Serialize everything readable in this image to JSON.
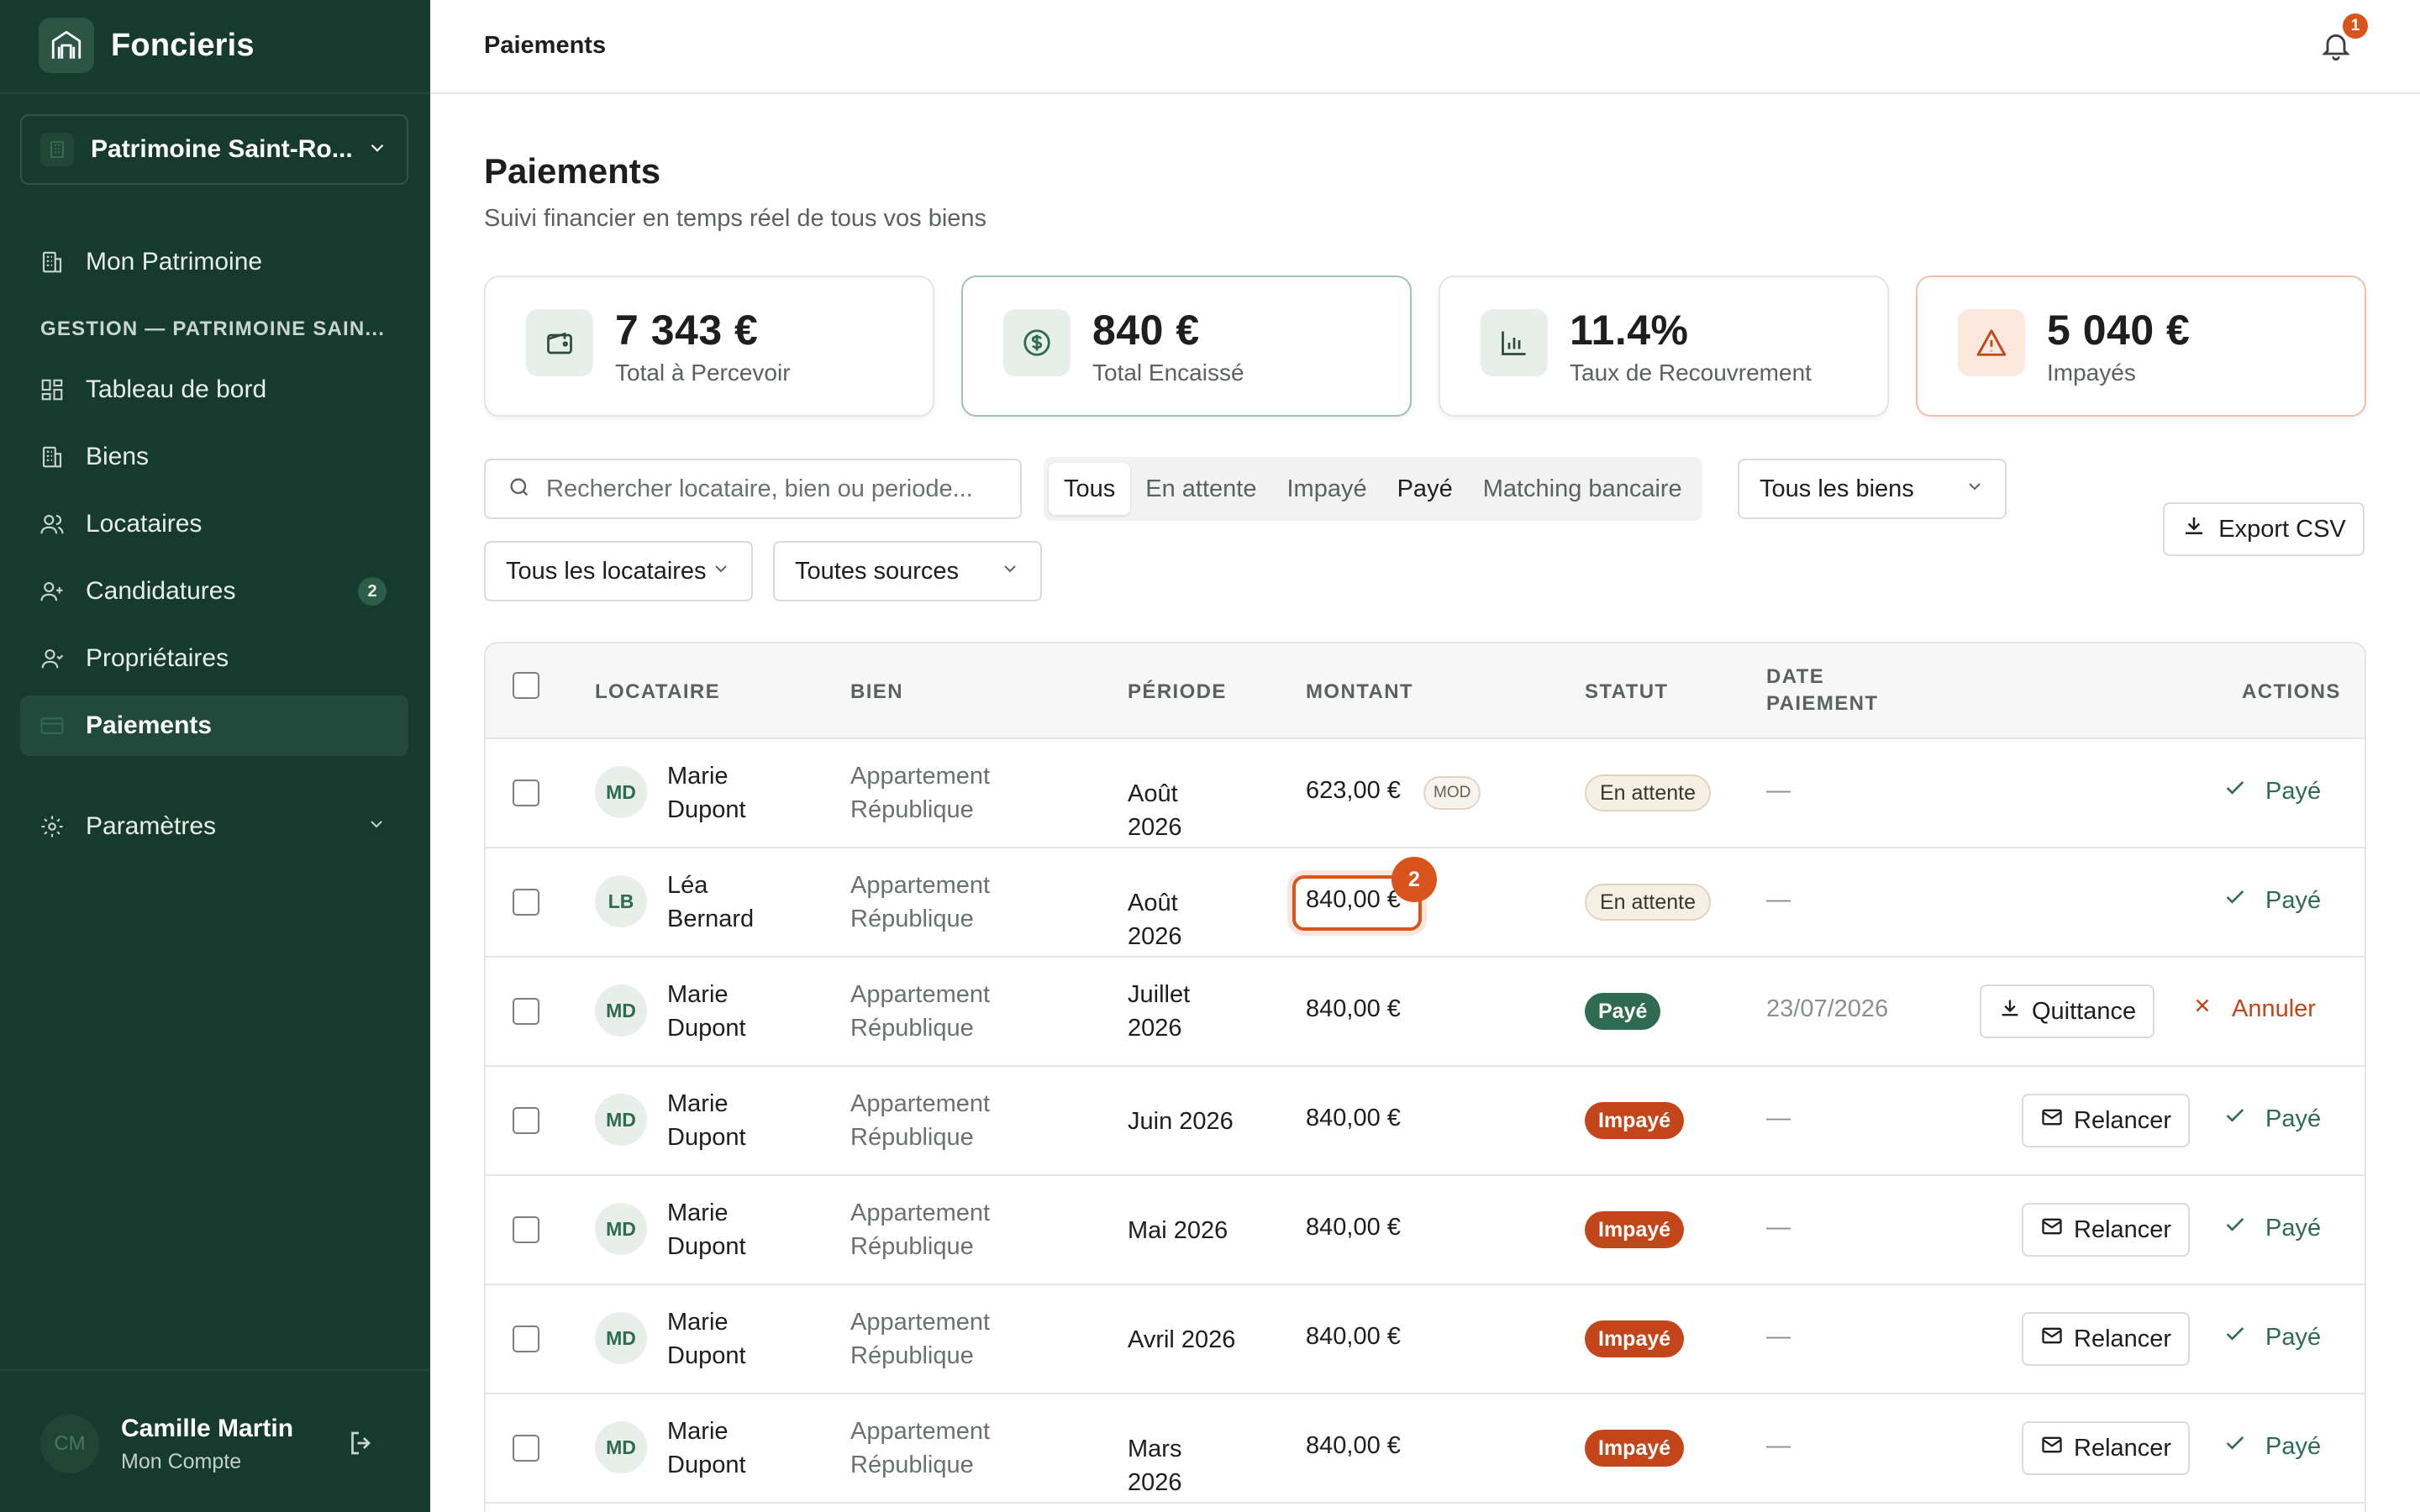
{
  "app": {
    "name": "Foncieris"
  },
  "sidebar": {
    "portfolio": "Patrimoine Saint-Ro...",
    "top_item": "Mon Patrimoine",
    "section": "GESTION — PATRIMOINE SAIN...",
    "items": [
      {
        "label": "Tableau de bord",
        "icon": "dashboard-icon"
      },
      {
        "label": "Biens",
        "icon": "building-icon"
      },
      {
        "label": "Locataires",
        "icon": "users-icon"
      },
      {
        "label": "Candidatures",
        "icon": "user-plus-icon",
        "badge": "2"
      },
      {
        "label": "Propriétaires",
        "icon": "owner-icon"
      },
      {
        "label": "Paiements",
        "icon": "credit-card-icon",
        "active": true
      }
    ],
    "settings": "Paramètres",
    "account": {
      "initials": "CM",
      "name": "Camille Martin",
      "sub": "Mon Compte"
    }
  },
  "topbar": {
    "title": "Paiements",
    "notifications": "1"
  },
  "page": {
    "title": "Paiements",
    "subtitle": "Suivi financier en temps réel de tous vos biens"
  },
  "stats": [
    {
      "value": "7 343 €",
      "label": "Total à Percevoir",
      "icon": "wallet-icon"
    },
    {
      "value": "840 €",
      "label": "Total Encaissé",
      "icon": "dollar-circle-icon"
    },
    {
      "value": "11.4%",
      "label": "Taux de Recouvrement",
      "icon": "bar-chart-icon"
    },
    {
      "value": "5 040 €",
      "label": "Impayés",
      "icon": "warning-icon"
    }
  ],
  "filters": {
    "search_placeholder": "Rechercher locataire, bien ou periode...",
    "tabs": [
      "Tous",
      "En attente",
      "Impayé",
      "Payé",
      "Matching bancaire"
    ],
    "active_tab": "Tous",
    "biens": "Tous les biens",
    "locataires": "Tous les locataires",
    "sources": "Toutes sources",
    "export": "Export CSV"
  },
  "table": {
    "headers": {
      "locataire": "LOCATAIRE",
      "bien": "BIEN",
      "periode": "PÉRIODE",
      "montant": "MONTANT",
      "statut": "STATUT",
      "date1": "DATE",
      "date2": "PAIEMENT",
      "actions": "ACTIONS"
    },
    "rows": [
      {
        "initials": "MD",
        "first": "Marie",
        "last": "Dupont",
        "bien1": "Appartement",
        "bien2": "République",
        "periode": "Août 2026",
        "montant": "623,00 €",
        "mod": "MOD",
        "statut": "En attente",
        "date": "—",
        "paid": "Payé"
      },
      {
        "initials": "LB",
        "first": "Léa",
        "last": "Bernard",
        "bien1": "Appartement",
        "bien2": "République",
        "periode": "Août 2026",
        "montant": "840,00 €",
        "highlight": "2",
        "statut": "En attente",
        "date": "—",
        "paid": "Payé"
      },
      {
        "initials": "MD",
        "first": "Marie",
        "last": "Dupont",
        "bien1": "Appartement",
        "bien2": "République",
        "periode1": "Juillet",
        "periode2": "2026",
        "montant": "840,00 €",
        "statut": "Payé",
        "date": "23/07/2026",
        "quittance": "Quittance",
        "cancel": "Annuler"
      },
      {
        "initials": "MD",
        "first": "Marie",
        "last": "Dupont",
        "bien1": "Appartement",
        "bien2": "République",
        "periode": "Juin 2026",
        "montant": "840,00 €",
        "statut": "Impayé",
        "date": "—",
        "relancer": "Relancer",
        "paid": "Payé"
      },
      {
        "initials": "MD",
        "first": "Marie",
        "last": "Dupont",
        "bien1": "Appartement",
        "bien2": "République",
        "periode": "Mai 2026",
        "montant": "840,00 €",
        "statut": "Impayé",
        "date": "—",
        "relancer": "Relancer",
        "paid": "Payé"
      },
      {
        "initials": "MD",
        "first": "Marie",
        "last": "Dupont",
        "bien1": "Appartement",
        "bien2": "République",
        "periode": "Avril 2026",
        "montant": "840,00 €",
        "statut": "Impayé",
        "date": "—",
        "relancer": "Relancer",
        "paid": "Payé"
      },
      {
        "initials": "MD",
        "first": "Marie",
        "last": "Dupont",
        "bien1": "Appartement",
        "bien2": "République",
        "periode": "Mars 2026",
        "montant": "840,00 €",
        "statut": "Impayé",
        "date": "—",
        "relancer": "Relancer",
        "paid": "Payé"
      }
    ]
  },
  "colors": {
    "sidebar": "#173a2e",
    "accent": "#2f6a52",
    "danger": "#c3461a",
    "notify": "#d9541d"
  }
}
